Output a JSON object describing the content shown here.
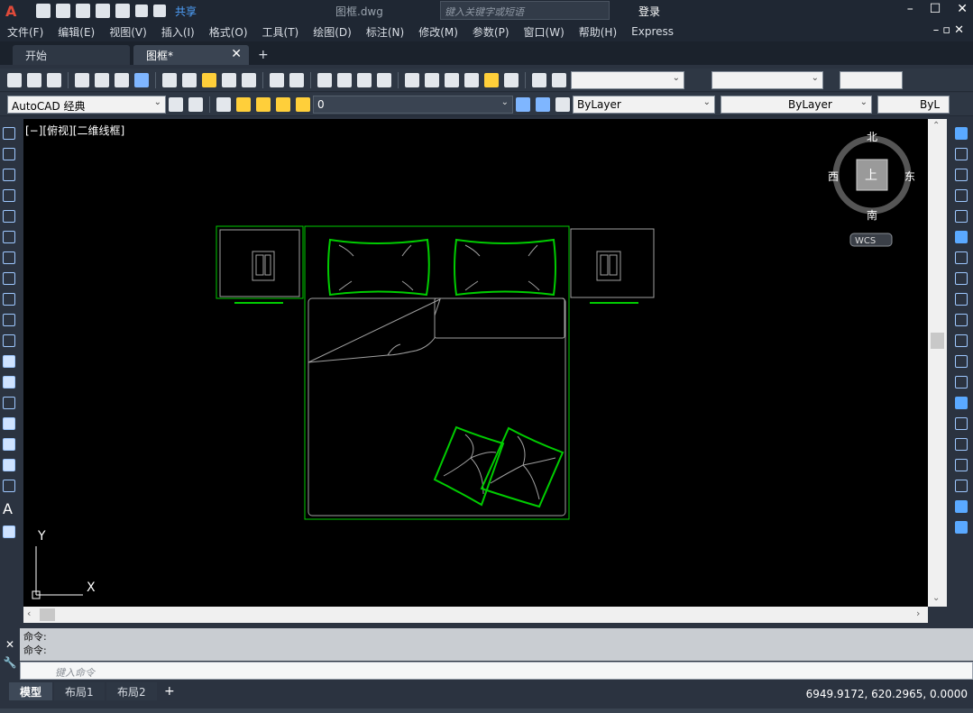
{
  "title_bar": {
    "share_label": "共享",
    "doc_title": "图框.dwg",
    "search_placeholder": "键入关键字或短语",
    "login_label": "登录"
  },
  "menu": [
    "文件(F)",
    "编辑(E)",
    "视图(V)",
    "插入(I)",
    "格式(O)",
    "工具(T)",
    "绘图(D)",
    "标注(N)",
    "修改(M)",
    "参数(P)",
    "窗口(W)",
    "帮助(H)",
    "Express"
  ],
  "doc_tabs": [
    {
      "label": "开始"
    },
    {
      "label": "图框*",
      "active": true
    }
  ],
  "toolbar2": {
    "workspace": "AutoCAD 经典",
    "layer": "0",
    "color": "ByLayer",
    "linetype": "ByLayer",
    "lineweight": "ByL"
  },
  "viewport": {
    "label": "[−][俯视][二维线框]",
    "compass": {
      "north": "北",
      "south": "南",
      "east": "东",
      "west": "西",
      "top": "上"
    },
    "wcs": "WCS",
    "axis_x": "X",
    "axis_y": "Y"
  },
  "command": {
    "history": [
      "命令:",
      "命令:"
    ],
    "placeholder": "键入命令"
  },
  "layout_tabs": [
    {
      "label": "模型",
      "active": true
    },
    {
      "label": "布局1"
    },
    {
      "label": "布局2"
    }
  ],
  "status": {
    "coords": "6949.9172, 620.2965, 0.0000"
  },
  "colors": {
    "drawing_green": "#00cc00",
    "drawing_gray": "#a0a0a0",
    "background": "#000000"
  }
}
